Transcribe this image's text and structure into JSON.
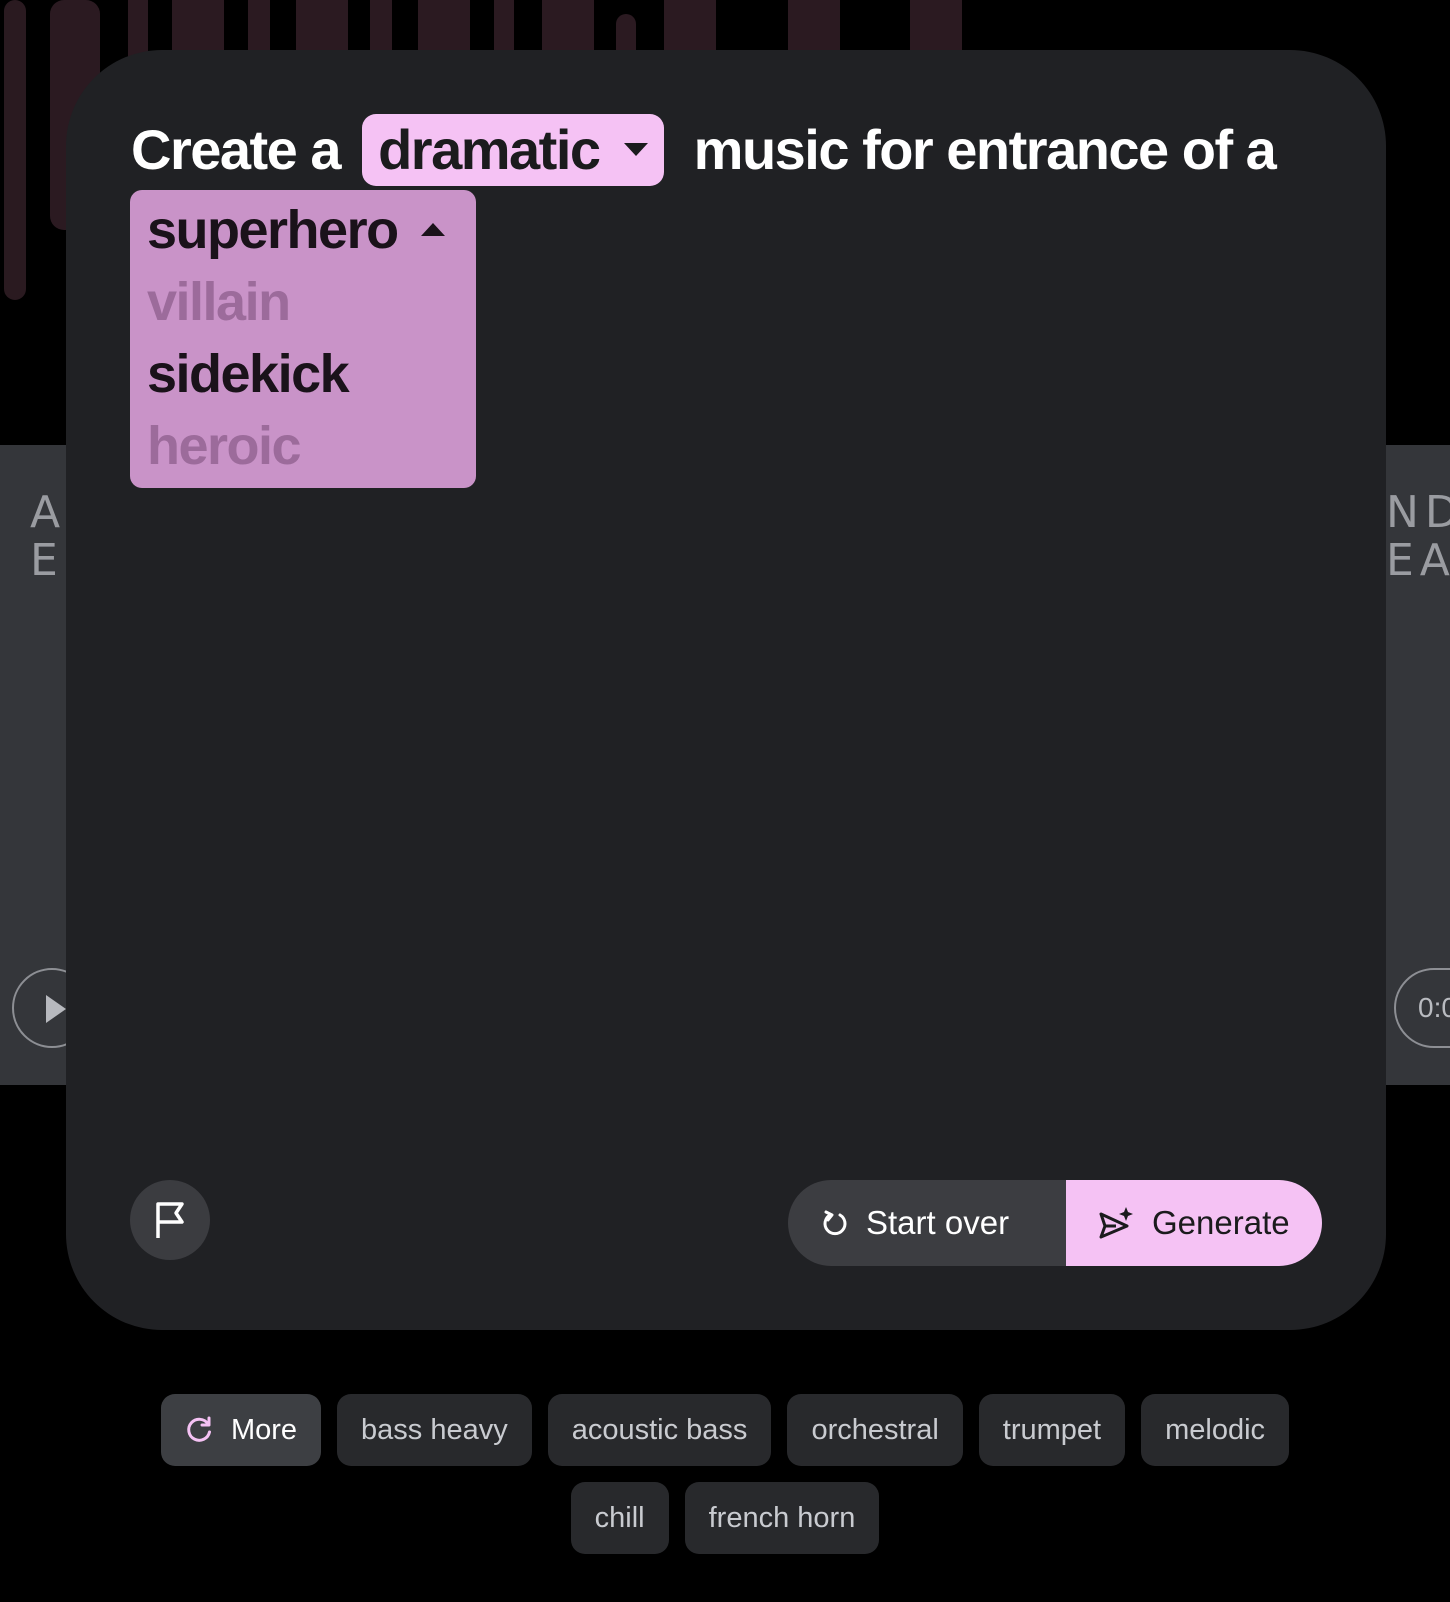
{
  "prompt": {
    "prefix": "Create a",
    "mood": {
      "selected": "dramatic",
      "icon": "caret-down-icon"
    },
    "middle": "music for entrance of a"
  },
  "character_dropdown": {
    "icon": "caret-up-icon",
    "options": [
      {
        "label": "superhero",
        "state": "selected"
      },
      {
        "label": "villain",
        "state": "dim"
      },
      {
        "label": "sidekick",
        "state": "normal"
      },
      {
        "label": "heroic",
        "state": "dim"
      }
    ]
  },
  "side_cards": {
    "left": {
      "title_line1": "A",
      "title_line2": "E",
      "icon": "play-icon"
    },
    "right": {
      "title_line1": "ND",
      "title_line2": "EA",
      "time": "0:0"
    }
  },
  "actions": {
    "report_icon": "flag-icon",
    "start_over": {
      "label": "Start over",
      "icon": "restart-icon"
    },
    "generate": {
      "label": "Generate",
      "icon": "send-sparkle-icon"
    }
  },
  "suggestions": {
    "more": {
      "label": "More",
      "icon": "refresh-icon"
    },
    "tags": [
      "bass heavy",
      "acoustic bass",
      "orchestral",
      "trumpet",
      "melodic",
      "chill",
      "french horn"
    ]
  },
  "colors": {
    "accent": "#f5c2f4",
    "dropdown_bg": "#c993c8",
    "card_bg": "#202124",
    "chip_bg": "#28292c"
  }
}
